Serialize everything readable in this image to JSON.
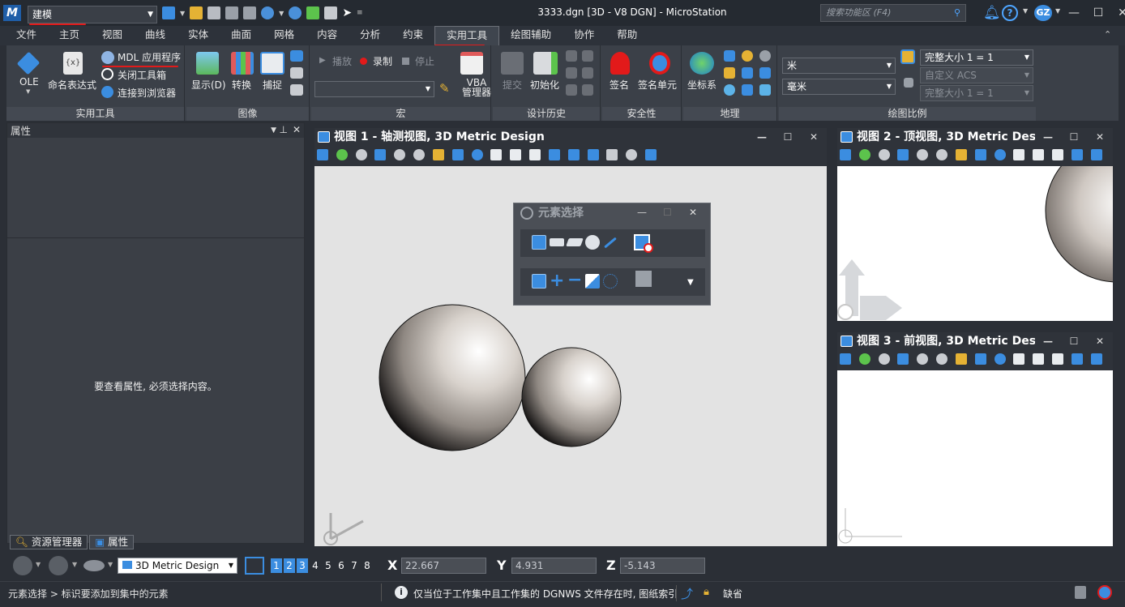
{
  "app": {
    "workflow_select": "建模",
    "document_title": "3333.dgn [3D - V8 DGN] - MicroStation",
    "search_placeholder": "搜索功能区 (F4)",
    "user_initials": "GZ"
  },
  "menu_tabs": [
    {
      "label": "文件"
    },
    {
      "label": "主页"
    },
    {
      "label": "视图"
    },
    {
      "label": "曲线"
    },
    {
      "label": "实体"
    },
    {
      "label": "曲面"
    },
    {
      "label": "网格"
    },
    {
      "label": "内容"
    },
    {
      "label": "分析"
    },
    {
      "label": "约束"
    },
    {
      "label": "实用工具"
    },
    {
      "label": "绘图辅助"
    },
    {
      "label": "协作"
    },
    {
      "label": "帮助"
    }
  ],
  "ribbon": {
    "utilities": {
      "group_label": "实用工具",
      "ole": "OLE",
      "named_expressions": "命名表达式",
      "mdl_apps": "MDL 应用程序",
      "close_toolboxes": "关闭工具箱",
      "connect_browser": "连接到浏览器"
    },
    "image": {
      "group_label": "图像",
      "display": "显示(D)",
      "convert": "转换",
      "capture": "捕捉"
    },
    "macro": {
      "group_label": "宏",
      "play": "播放",
      "record": "录制",
      "stop": "停止",
      "vba_manager": "VBA\n管理器",
      "vba_line1": "VBA",
      "vba_line2": "管理器"
    },
    "design_history": {
      "group_label": "设计历史",
      "commit": "提交",
      "initialize": "初始化"
    },
    "security": {
      "group_label": "安全性",
      "sign": "签名",
      "sign_cell": "签名单元"
    },
    "geographic": {
      "group_label": "地理",
      "coord_system": "坐标系"
    },
    "drawing_scale": {
      "group_label": "绘图比例",
      "unit_master": "米",
      "unit_sub": "毫米",
      "scale": "完整大小 1 = 1",
      "acs": "自定义 ACS",
      "scale2": "完整大小 1 = 1"
    }
  },
  "properties_panel": {
    "title": "属性",
    "empty_message": "要查看属性, 必须选择内容。",
    "tabs": [
      {
        "label": "资源管理器"
      },
      {
        "label": "属性"
      }
    ]
  },
  "views": [
    {
      "title": "视图 1 - 轴测视图, 3D Metric Design"
    },
    {
      "title": "视图 2 - 顶视图, 3D Metric Design"
    },
    {
      "title": "视图 3 - 前视图, 3D Metric Design"
    }
  ],
  "element_selection": {
    "title": "元素选择"
  },
  "bottom_bar": {
    "model": "3D Metric Design",
    "view_numbers": [
      "1",
      "2",
      "3",
      "4",
      "5",
      "6",
      "7",
      "8"
    ],
    "x_label": "X",
    "x_value": "22.667",
    "y_label": "Y",
    "y_value": "4.931",
    "z_label": "Z",
    "z_value": "-5.143"
  },
  "status_bar": {
    "prompt": "元素选择 > 标识要添加到集中的元素",
    "message": "仅当位于工作集中且工作集的 DGNWS 文件存在时, 图纸索引",
    "default_level": "缺省"
  },
  "colors": {
    "accent_blue": "#3b8de0",
    "annotation_red": "#e21a1a",
    "view_background_iso": "#e3e3e3",
    "view_background_ortho": "#ffffff"
  }
}
